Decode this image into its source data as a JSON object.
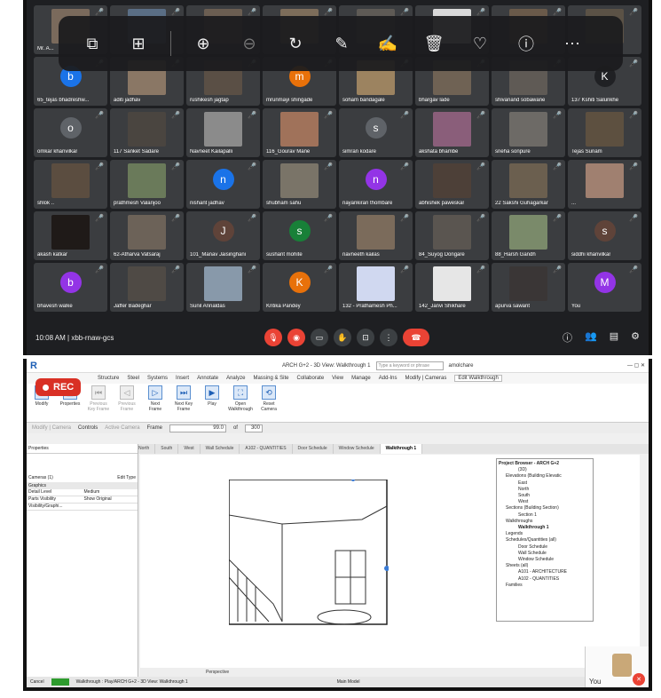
{
  "meet": {
    "time": "10:08 AM  |  xbb-rnaw-gcs"
  },
  "participants": [
    {
      "name": "Mr. A...",
      "kind": "cam",
      "color": "#7a6a5c"
    },
    {
      "name": "",
      "kind": "cam",
      "color": "#5a6e85"
    },
    {
      "name": "",
      "kind": "cam",
      "color": "#6b5e52"
    },
    {
      "name": "",
      "kind": "cam",
      "color": "#7d6d5a"
    },
    {
      "name": "",
      "kind": "cam",
      "color": "#5e5a55"
    },
    {
      "name": "",
      "kind": "cam",
      "color": "#d9d9d9"
    },
    {
      "name": "",
      "kind": "cam",
      "color": "#6a5a4a"
    },
    {
      "name": "",
      "kind": "cam",
      "color": "#5b5246"
    },
    {
      "name": "65_tejas bhadreshw...",
      "kind": "av",
      "letter": "b",
      "color": "#1a73e8"
    },
    {
      "name": "aditi jadhav",
      "kind": "cam",
      "color": "#8a7765"
    },
    {
      "name": "rushikesh jagtap",
      "kind": "cam",
      "color": "#5a4f45"
    },
    {
      "name": "mrunmayi shingade",
      "kind": "av",
      "letter": "m",
      "color": "#e8710a"
    },
    {
      "name": "soham bandagale",
      "kind": "cam",
      "color": "#9c8360"
    },
    {
      "name": "bhargav lade",
      "kind": "cam",
      "color": "#6f6254"
    },
    {
      "name": "shivanand sobawane",
      "kind": "cam",
      "color": "#5f5a55"
    },
    {
      "name": "137 Kshiti Salunkhe",
      "kind": "av",
      "letter": "K",
      "color": "#202124"
    },
    {
      "name": "omkar khanvilkar",
      "kind": "av",
      "letter": "o",
      "color": "#5f6368"
    },
    {
      "name": "117 Sanket Sadare",
      "kind": "cam",
      "color": "#4a4540"
    },
    {
      "name": "Navneet Kailapalli",
      "kind": "cam",
      "color": "#8b8b8b"
    },
    {
      "name": "116_Gourav Mane",
      "kind": "cam",
      "color": "#a0725a"
    },
    {
      "name": "simran kodare",
      "kind": "av",
      "letter": "s",
      "color": "#5f6368"
    },
    {
      "name": "akshata bhambe",
      "kind": "cam",
      "color": "#8a5e7a"
    },
    {
      "name": "sneha sonpure",
      "kind": "cam",
      "color": "#6d6a66"
    },
    {
      "name": "Tejas Sunam",
      "kind": "cam",
      "color": "#5d5040"
    },
    {
      "name": "shlok ..",
      "kind": "cam",
      "color": "#5b4d40"
    },
    {
      "name": "prathmesh Valanjoo",
      "kind": "cam",
      "color": "#6a7a5a"
    },
    {
      "name": "nishant jadhav",
      "kind": "av",
      "letter": "n",
      "color": "#1a73e8"
    },
    {
      "name": "shubham sahu",
      "kind": "cam",
      "color": "#7a7468"
    },
    {
      "name": "nayankiran thombare",
      "kind": "av",
      "letter": "n",
      "color": "#9334e6"
    },
    {
      "name": "abhishek paweskar",
      "kind": "cam",
      "color": "#4d4038"
    },
    {
      "name": "22 Sakshi Guhagarkar",
      "kind": "cam",
      "color": "#6b5f4f"
    },
    {
      "name": "...",
      "kind": "cam",
      "color": "#a08070"
    },
    {
      "name": "akash katkar",
      "kind": "cam",
      "color": "#1f1a18"
    },
    {
      "name": "62-Atharva Vatsaraj",
      "kind": "cam",
      "color": "#6c6258"
    },
    {
      "name": "101_Manav Jaisinghani",
      "kind": "av",
      "letter": "J",
      "color": "#5f4339"
    },
    {
      "name": "sushant mohite",
      "kind": "av",
      "letter": "s",
      "color": "#188038"
    },
    {
      "name": "navneeth kailas",
      "kind": "cam",
      "color": "#7b6b5b"
    },
    {
      "name": "84_Suyog Dongare",
      "kind": "cam",
      "color": "#5a5550"
    },
    {
      "name": "88_Harsh Gandh",
      "kind": "cam",
      "color": "#7a8a6a"
    },
    {
      "name": "siddhi khanvilkar",
      "kind": "av",
      "letter": "s",
      "color": "#5f4339"
    },
    {
      "name": "bhavesh walke",
      "kind": "av",
      "letter": "b",
      "color": "#9334e6"
    },
    {
      "name": "Jaffer Badeghar",
      "kind": "cam",
      "color": "#4f4a45"
    },
    {
      "name": "Sunil Annaldas",
      "kind": "cam",
      "color": "#8899aa"
    },
    {
      "name": "Kritika Pandey",
      "kind": "av",
      "letter": "K",
      "color": "#e8710a"
    },
    {
      "name": "132 - Prathamesh Ph...",
      "kind": "cam",
      "color": "#d0d8f0"
    },
    {
      "name": "142_Janvi Shikhare",
      "kind": "cam",
      "color": "#e6e6e6"
    },
    {
      "name": "apurva sawant",
      "kind": "cam",
      "color": "#3a3636"
    },
    {
      "name": "You",
      "kind": "av",
      "letter": "M",
      "color": "#9334e6"
    }
  ],
  "revit": {
    "title": "ARCH G+2 - 3D View: Walkthrough 1",
    "search_placeholder": "Type a keyword or phrase",
    "user": "amolchare",
    "tabs": [
      "Structure",
      "Steel",
      "Systems",
      "Insert",
      "Annotate",
      "Analyze",
      "Massing & Site",
      "Collaborate",
      "View",
      "Manage",
      "Add-Ins",
      "Modify | Cameras",
      "Edit Walkthrough"
    ],
    "ribbon": [
      {
        "label": "Modify",
        "icon": "↖",
        "disabled": false
      },
      {
        "label": "Properties",
        "icon": "▦",
        "disabled": false
      },
      {
        "label": "Previous Key Frame",
        "icon": "⏮",
        "disabled": true
      },
      {
        "label": "Previous Frame",
        "icon": "◁",
        "disabled": true
      },
      {
        "label": "Next Frame",
        "icon": "▷",
        "disabled": false
      },
      {
        "label": "Next Key Frame",
        "icon": "⏭",
        "disabled": false
      },
      {
        "label": "Play",
        "icon": "▶",
        "disabled": false
      },
      {
        "label": "Open Walkthrough",
        "icon": "⛶",
        "disabled": false
      },
      {
        "label": "Reset Camera",
        "icon": "⟲",
        "disabled": false
      }
    ],
    "groups": {
      "select": "Select",
      "properties": "Properties",
      "walkthrough": "Walkthrough"
    },
    "options": {
      "modify": "Modify | Camera",
      "controls": "Controls",
      "active_camera": "Active Camera",
      "frame_label": "Frame",
      "frame_value": "99.0",
      "of": "of",
      "total": "300"
    },
    "rec": "REC",
    "view_tabs": [
      "North",
      "South",
      "West",
      "Wall Schedule",
      "A102 - QUANTITIES",
      "Door Schedule",
      "Window Schedule",
      "Walkthrough 1"
    ],
    "properties": {
      "title": "Properties",
      "type": "Cameras (1)",
      "edit_type": "Edit Type",
      "group": "Graphics",
      "rows": [
        [
          "Detail Level",
          "Medium"
        ],
        [
          "Parts Visibility",
          "Show Original"
        ],
        [
          "Visibility/Graphi...",
          ""
        ]
      ]
    },
    "browser": {
      "title": "Project Browser - ARCH G+2",
      "items": [
        "(3D)",
        "Elevations (Building Elevatic",
        "East",
        "North",
        "South",
        "West",
        "Sections (Building Section)",
        "Section 1",
        "Walkthroughs",
        "Walkthrough 1",
        "Legends",
        "Schedules/Quantities (all)",
        "Door Schedule",
        "Wall Schedule",
        "Window Schedule",
        "Sheets (all)",
        "A101 - ARCHITECTURE",
        "A102 - QUANTITIES",
        "Families"
      ]
    },
    "view_bar": "Perspective",
    "status": {
      "cancel": "Cancel",
      "text": "Walkthrough : Play/ARCH G+2 - 3D View: Walkthrough 1",
      "main_model": "Main Model"
    },
    "you_label": "You"
  }
}
